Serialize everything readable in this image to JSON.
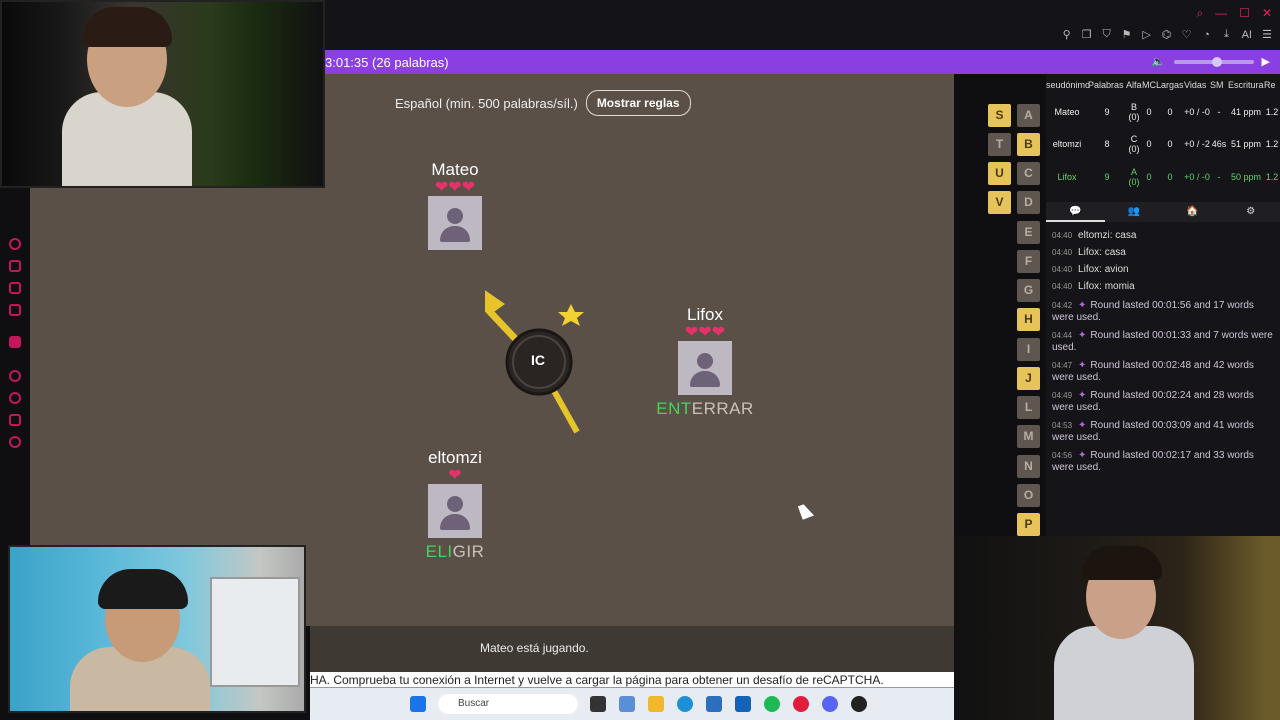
{
  "game": {
    "timer_text": "3:01:35 (26 palabras)",
    "language_text": "Español (min. 500 palabras/síl.)",
    "rules_button": "Mostrar reglas",
    "syllable": "IC",
    "status": "Mateo está jugando.",
    "players": [
      {
        "name": "Mateo",
        "hearts": "❤❤❤",
        "typed": "",
        "rest": ""
      },
      {
        "name": "Lifox",
        "hearts": "❤❤❤",
        "typed": "ENT",
        "rest": "ERRAR"
      },
      {
        "name": "eltomzi",
        "hearts": "❤",
        "typed": "ELI",
        "rest": "GIR"
      }
    ],
    "letters_left": [
      "S",
      "T",
      "U",
      "V"
    ],
    "letters_right": [
      "A",
      "B",
      "C",
      "D",
      "E",
      "F",
      "G",
      "H",
      "I",
      "J",
      "L",
      "M",
      "N",
      "O",
      "P"
    ],
    "letters_on_left": [
      "S",
      "U",
      "V"
    ],
    "letters_on_right": [
      "B",
      "H",
      "J",
      "P"
    ]
  },
  "stats": {
    "headers": [
      "seudónimo",
      "Palabras",
      "Alfa",
      "MC",
      "Largas",
      "Vidas",
      "SM",
      "Escritura",
      "Re"
    ],
    "rows": [
      {
        "name": "Mateo",
        "palabras": "9",
        "alfa": "B (0)",
        "mc": "0",
        "largas": "0",
        "vidas": "+0 / -0",
        "sm": "-",
        "escritura": "41 ppm",
        "re": "1.2"
      },
      {
        "name": "eltomzi",
        "palabras": "8",
        "alfa": "C (0)",
        "mc": "0",
        "largas": "0",
        "vidas": "+0 / -2",
        "sm": "46s",
        "escritura": "51 ppm",
        "re": "1.2"
      },
      {
        "name": "Lifox",
        "palabras": "9",
        "alfa": "A (0)",
        "mc": "0",
        "largas": "0",
        "vidas": "+0 / -0",
        "sm": "-",
        "escritura": "50 ppm",
        "re": "1.2"
      }
    ]
  },
  "chat": [
    {
      "ts": "04:40",
      "text": "eltomzi: casa",
      "sys": false
    },
    {
      "ts": "04:40",
      "text": "Lifox: casa",
      "sys": false
    },
    {
      "ts": "04:40",
      "text": "Lifox: avion",
      "sys": false
    },
    {
      "ts": "04:40",
      "text": "Lifox: momia",
      "sys": false
    },
    {
      "ts": "04:42",
      "text": "Round lasted 00:01:56 and 17 words were used.",
      "sys": true
    },
    {
      "ts": "04:44",
      "text": "Round lasted 00:01:33 and 7 words were used.",
      "sys": true
    },
    {
      "ts": "04:47",
      "text": "Round lasted 00:02:48 and 42 words were used.",
      "sys": true
    },
    {
      "ts": "04:49",
      "text": "Round lasted 00:02:24 and 28 words were used.",
      "sys": true
    },
    {
      "ts": "04:53",
      "text": "Round lasted 00:03:09 and 41 words were used.",
      "sys": true
    },
    {
      "ts": "04:56",
      "text": "Round lasted 00:02:17 and 33 words were used.",
      "sys": true
    }
  ],
  "captcha_text": "HA. Comprueba tu conexión a Internet y vuelve a cargar la página para obtener un desafío de reCAPTCHA.",
  "taskbar": {
    "search_placeholder": "Buscar"
  },
  "browser": {
    "ai_label": "AI"
  },
  "colors": {
    "accent": "#8a3fe0",
    "letter_on": "#e6c45a",
    "heart": "#e8306a",
    "typed": "#44d45a"
  }
}
